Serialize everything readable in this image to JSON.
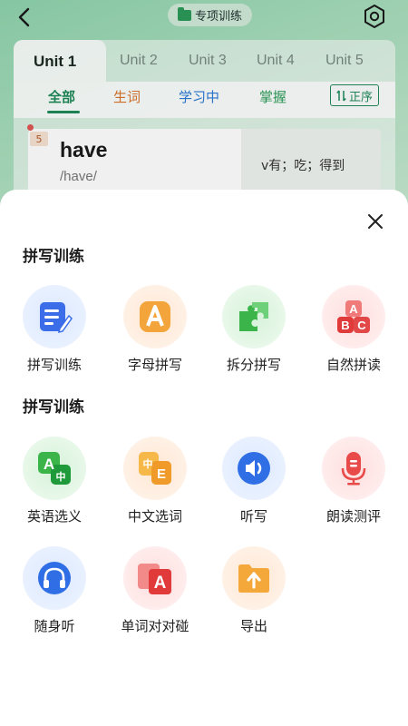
{
  "header": {
    "title": "专项训练",
    "back_icon": "back-arrow-icon",
    "settings_icon": "settings-gear-icon"
  },
  "unit_tabs": [
    "Unit 1",
    "Unit 2",
    "Unit 3",
    "Unit 4",
    "Unit 5"
  ],
  "active_unit": "Unit 1",
  "filters": {
    "all": "全部",
    "new_words": "生词",
    "learning": "学习中",
    "mastered": "掌握",
    "sort": "正序"
  },
  "word_card": {
    "badge": "5",
    "word": "have",
    "phonetic": "/have/",
    "meaning": "v有；吃；得到"
  },
  "sheet": {
    "section1_title": "拼写训练",
    "section2_title": "拼写训练",
    "section1_items": [
      {
        "label": "拼写训练",
        "icon": "pencil-note-icon"
      },
      {
        "label": "字母拼写",
        "icon": "letter-a-icon"
      },
      {
        "label": "拆分拼写",
        "icon": "puzzle-icon"
      },
      {
        "label": "自然拼读",
        "icon": "abc-blocks-icon"
      }
    ],
    "section2_items": [
      {
        "label": "英语选义",
        "icon": "translate-a-zh-icon"
      },
      {
        "label": "中文选词",
        "icon": "translate-zh-e-icon"
      },
      {
        "label": "听写",
        "icon": "speaker-icon"
      },
      {
        "label": "朗读测评",
        "icon": "microphone-icon"
      },
      {
        "label": "随身听",
        "icon": "headphones-icon"
      },
      {
        "label": "单词对对碰",
        "icon": "match-cards-icon"
      },
      {
        "label": "导出",
        "icon": "export-folder-icon"
      }
    ]
  },
  "colors": {
    "accent_green": "#1f8a5a",
    "new_word_orange": "#d9742b",
    "learning_blue": "#2b7bd6",
    "mastered_green": "#2a9a58"
  }
}
